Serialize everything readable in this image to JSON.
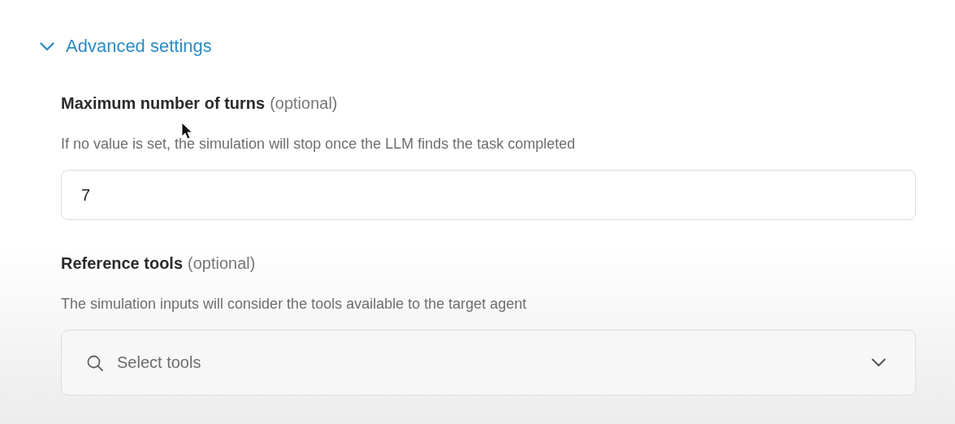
{
  "section": {
    "title": "Advanced settings",
    "expanded": true
  },
  "fields": [
    {
      "kind": "text",
      "label": "Maximum number of turns",
      "note": "(optional)",
      "description": "If no value is set, the simulation will stop once the LLM finds the task completed",
      "value": "7"
    },
    {
      "kind": "select",
      "label": "Reference tools",
      "note": "(optional)",
      "description": "The simulation inputs will consider the tools available to the target agent",
      "placeholder": "Select tools"
    }
  ]
}
